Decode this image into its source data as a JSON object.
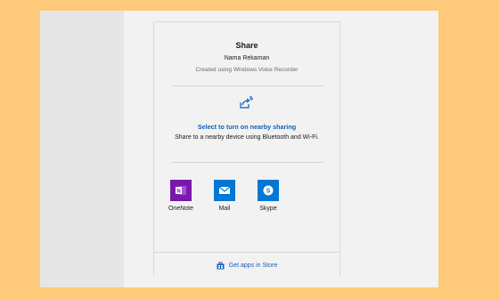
{
  "share": {
    "title": "Share",
    "item_name": "Nama Rekaman",
    "created_with": "Created using Windows Voice Recorder",
    "nearby_link": "Select to turn on nearby sharing",
    "nearby_desc": "Share to a nearby device using Bluetooth and Wi-Fi.",
    "store_link": "Get apps in Store"
  },
  "apps": [
    {
      "label": "OneNote",
      "icon": "onenote-icon",
      "color": "#7719aa"
    },
    {
      "label": "Mail",
      "icon": "mail-icon",
      "color": "#0078d4"
    },
    {
      "label": "Skype",
      "icon": "skype-icon",
      "color": "#0078d4"
    }
  ],
  "colors": {
    "background": "#fec97a",
    "accent": "#1060b8"
  }
}
